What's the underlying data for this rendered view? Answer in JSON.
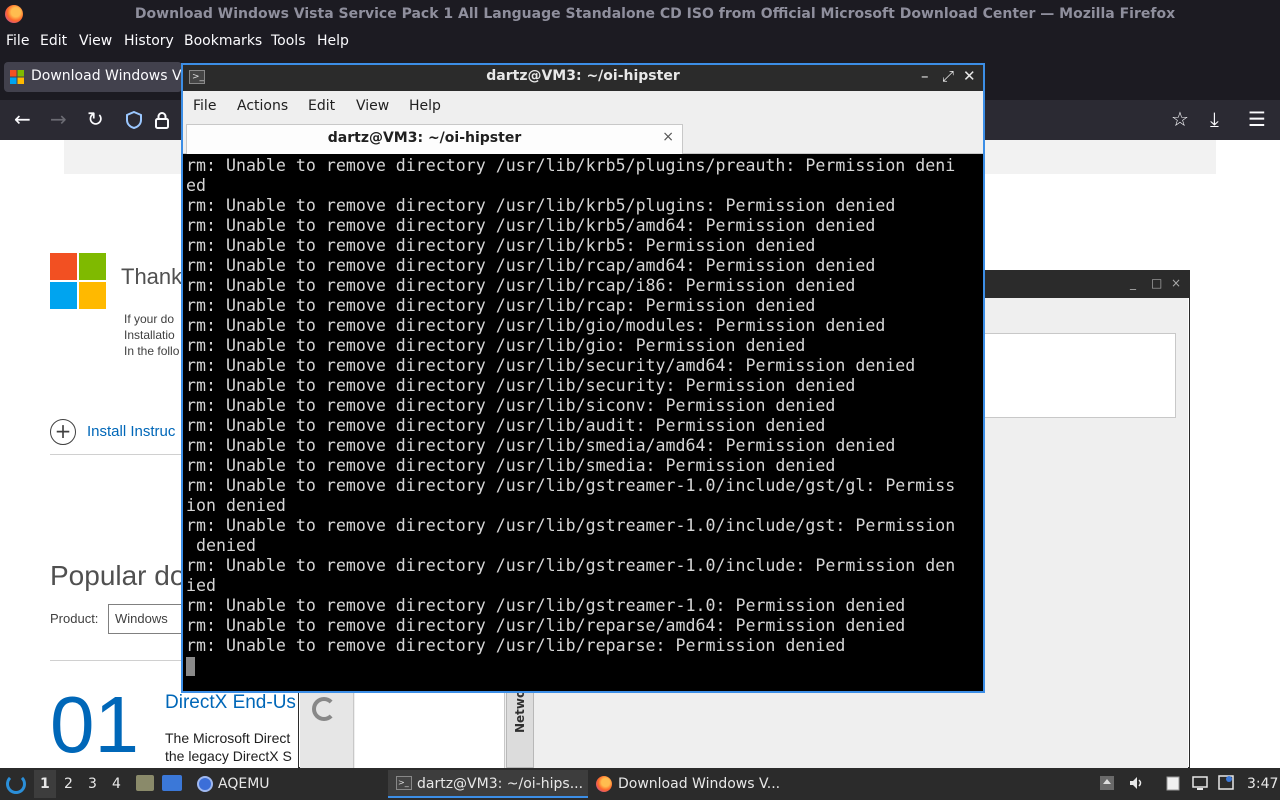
{
  "firefox": {
    "window_title": "Download Windows Vista Service Pack 1 All Language Standalone CD ISO from Official Microsoft Download Center — Mozilla Firefox",
    "menu": [
      "File",
      "Edit",
      "View",
      "History",
      "Bookmarks",
      "Tools",
      "Help"
    ],
    "tab_label": "Download Windows Vis",
    "nav_icons": [
      "back-icon",
      "forward-icon",
      "reload-icon",
      "shield-icon",
      "lock-icon",
      "star-icon",
      "download-icon",
      "menu-icon"
    ]
  },
  "page": {
    "thank": "Thank",
    "small_lines": [
      "If your do",
      "Installatio",
      "In the follo"
    ],
    "install_link": "Install Instruc",
    "popular_heading": "Popular do",
    "product_label": "Product:",
    "product_value": "Windows",
    "number": "01",
    "dx_title": "DirectX End-Us",
    "dx_desc": [
      "The Microsoft Direct",
      "the legacy DirectX S"
    ]
  },
  "bg_window": {
    "side_tab": "Network",
    "controls": [
      "_",
      "□",
      "×"
    ]
  },
  "terminal": {
    "title": "dartz@VM3: ~/oi-hipster",
    "menu": [
      "File",
      "Actions",
      "Edit",
      "View",
      "Help"
    ],
    "tab_label": "dartz@VM3: ~/oi-hipster",
    "close_glyph": "×",
    "window_controls": [
      "–",
      "⤢",
      "✕"
    ],
    "lines": [
      "rm: Unable to remove directory /usr/lib/krb5/plugins/preauth: Permission deni",
      "ed",
      "rm: Unable to remove directory /usr/lib/krb5/plugins: Permission denied",
      "rm: Unable to remove directory /usr/lib/krb5/amd64: Permission denied",
      "rm: Unable to remove directory /usr/lib/krb5: Permission denied",
      "rm: Unable to remove directory /usr/lib/rcap/amd64: Permission denied",
      "rm: Unable to remove directory /usr/lib/rcap/i86: Permission denied",
      "rm: Unable to remove directory /usr/lib/rcap: Permission denied",
      "rm: Unable to remove directory /usr/lib/gio/modules: Permission denied",
      "rm: Unable to remove directory /usr/lib/gio: Permission denied",
      "rm: Unable to remove directory /usr/lib/security/amd64: Permission denied",
      "rm: Unable to remove directory /usr/lib/security: Permission denied",
      "rm: Unable to remove directory /usr/lib/siconv: Permission denied",
      "rm: Unable to remove directory /usr/lib/audit: Permission denied",
      "rm: Unable to remove directory /usr/lib/smedia/amd64: Permission denied",
      "rm: Unable to remove directory /usr/lib/smedia: Permission denied",
      "rm: Unable to remove directory /usr/lib/gstreamer-1.0/include/gst/gl: Permiss",
      "ion denied",
      "rm: Unable to remove directory /usr/lib/gstreamer-1.0/include/gst: Permission",
      " denied",
      "rm: Unable to remove directory /usr/lib/gstreamer-1.0/include: Permission den",
      "ied",
      "rm: Unable to remove directory /usr/lib/gstreamer-1.0: Permission denied",
      "rm: Unable to remove directory /usr/lib/reparse/amd64: Permission denied",
      "rm: Unable to remove directory /usr/lib/reparse: Permission denied"
    ]
  },
  "taskbar": {
    "workspaces": [
      "1",
      "2",
      "3",
      "4"
    ],
    "aqemu_label": "AQEMU",
    "terminal_label": "dartz@VM3: ~/oi-hips...",
    "firefox_label": "Download Windows V...",
    "clock": "3:47"
  },
  "colors": {
    "ms_red": "#f25022",
    "ms_green": "#7fba00",
    "ms_blue": "#00a4ef",
    "ms_yellow": "#ffb900",
    "accent_blue": "#3c8ee6",
    "link_blue": "#0067b8"
  }
}
